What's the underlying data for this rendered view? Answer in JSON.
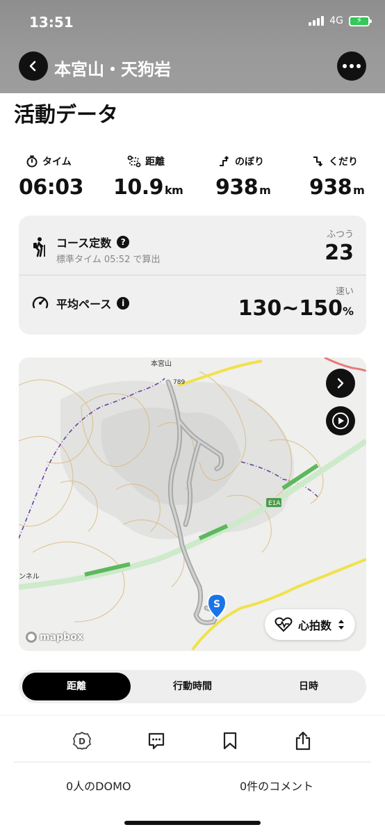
{
  "status_bar": {
    "time": "13:51",
    "network": "4G"
  },
  "header": {
    "title": "本宮山・天狗岩"
  },
  "section_title": "活動データ",
  "stats": [
    {
      "label": "タイム",
      "value": "06:03",
      "unit": ""
    },
    {
      "label": "距離",
      "value": "10.9",
      "unit": "km"
    },
    {
      "label": "のぼり",
      "value": "938",
      "unit": "m"
    },
    {
      "label": "くだり",
      "value": "938",
      "unit": "m"
    }
  ],
  "course": {
    "title": "コース定数",
    "subtitle": "標準タイム 05:52 で算出",
    "right_label": "ふつう",
    "value": "23"
  },
  "pace": {
    "title": "平均ペース",
    "right_label": "速い",
    "value": "130~150",
    "unit": "%"
  },
  "map": {
    "labels": {
      "peak": "本宮山",
      "elevation": "789",
      "road": "E1A",
      "tunnel": "ンネル"
    },
    "start_marker": "S",
    "attribution": "mapbox",
    "metric_selector": "心拍数"
  },
  "segment": {
    "items": [
      "距離",
      "行動時間",
      "日時"
    ],
    "active": 0
  },
  "footer": {
    "domo_text": "0人のDOMO",
    "comment_text": "0件のコメント"
  },
  "colors": {
    "accent_route": "#b9b9b9",
    "start_marker": "#1a73e8",
    "highway": "#5cb85c",
    "contour": "#d9b87a",
    "boundary": "#6b3fa0"
  }
}
